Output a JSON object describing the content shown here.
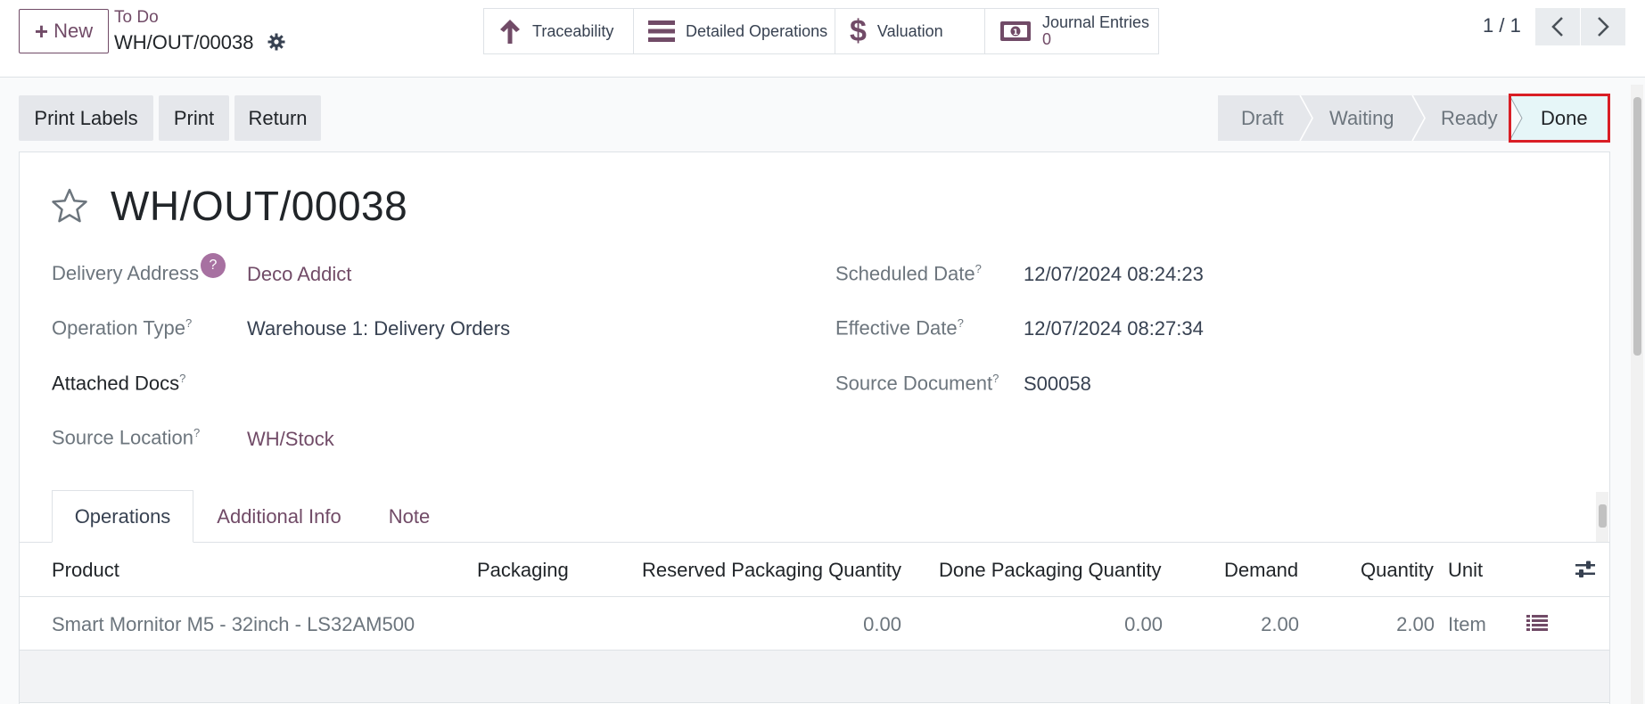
{
  "header": {
    "new_label": "New",
    "breadcrumb_parent": "To Do",
    "breadcrumb_current": "WH/OUT/00038",
    "pager": "1 / 1"
  },
  "smart_buttons": {
    "traceability": "Traceability",
    "detailed_operations": "Detailed Operations",
    "valuation": "Valuation",
    "journal_entries_label": "Journal Entries",
    "journal_entries_count": "0"
  },
  "actions": {
    "print_labels": "Print Labels",
    "print": "Print",
    "return": "Return"
  },
  "status": {
    "stages": [
      "Draft",
      "Waiting",
      "Ready",
      "Done"
    ],
    "current": "Done"
  },
  "record": {
    "title": "WH/OUT/00038",
    "left": [
      {
        "label": "Delivery Address",
        "value": "Deco Addict",
        "help": "?"
      },
      {
        "label": "Operation Type",
        "value": "Warehouse 1: Delivery Orders"
      },
      {
        "label": "Attached Docs",
        "value": ""
      },
      {
        "label": "Source Location",
        "value": "WH/Stock"
      }
    ],
    "right": [
      {
        "label": "Scheduled Date",
        "value": "12/07/2024 08:24:23"
      },
      {
        "label": "Effective Date",
        "value": "12/07/2024 08:27:34"
      },
      {
        "label": "Source Document",
        "value": "S00058"
      }
    ],
    "tooltip_mark": "?"
  },
  "tabs": [
    "Operations",
    "Additional Info",
    "Note"
  ],
  "table": {
    "columns": [
      "Product",
      "Packaging",
      "Reserved Packaging Quantity",
      "Done Packaging Quantity",
      "Demand",
      "Quantity",
      "Unit"
    ],
    "rows": [
      {
        "product": "Smart Mornitor M5 - 32inch - LS32AM500",
        "packaging": "",
        "reserved_packaging_qty": "0.00",
        "done_packaging_qty": "0.00",
        "demand": "2.00",
        "quantity": "2.00",
        "unit": "Item"
      }
    ]
  },
  "colors": {
    "brand": "#714b67",
    "done_highlight": "#d91e25"
  }
}
